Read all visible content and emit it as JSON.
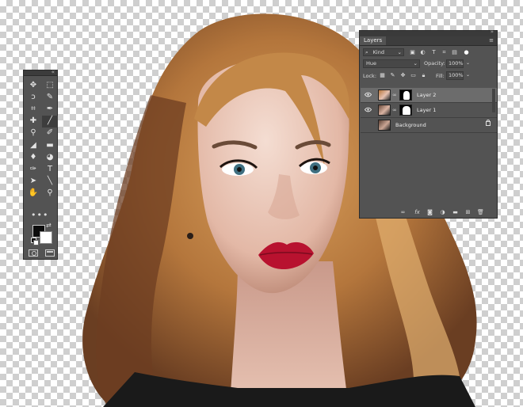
{
  "canvas": {
    "image": "portrait of woman with wavy hair and red lips on transparent background"
  },
  "tools_panel": {
    "more_glyph": "•••",
    "collapse_glyph": "«",
    "tools": [
      {
        "name": "move-tool",
        "glyph": "✥"
      },
      {
        "name": "marquee-tool",
        "glyph": "⬚"
      },
      {
        "name": "lasso-tool",
        "glyph": "ↄ"
      },
      {
        "name": "quick-select-tool",
        "glyph": "✎"
      },
      {
        "name": "crop-tool",
        "glyph": "⌗"
      },
      {
        "name": "eyedropper-tool",
        "glyph": "✒"
      },
      {
        "name": "healing-brush-tool",
        "glyph": "✚"
      },
      {
        "name": "brush-tool",
        "glyph": "╱"
      },
      {
        "name": "clone-stamp-tool",
        "glyph": "⚲"
      },
      {
        "name": "history-brush-tool",
        "glyph": "✐"
      },
      {
        "name": "eraser-tool",
        "glyph": "◢"
      },
      {
        "name": "gradient-tool",
        "glyph": "▬"
      },
      {
        "name": "blur-tool",
        "glyph": "♦"
      },
      {
        "name": "dodge-tool",
        "glyph": "◕"
      },
      {
        "name": "pen-tool",
        "glyph": "✑"
      },
      {
        "name": "type-tool",
        "glyph": "T"
      },
      {
        "name": "path-select-tool",
        "glyph": "➤"
      },
      {
        "name": "line-tool",
        "glyph": "╲"
      },
      {
        "name": "hand-tool",
        "glyph": "✋"
      },
      {
        "name": "zoom-tool",
        "glyph": "⚲"
      }
    ]
  },
  "layers_panel": {
    "tab_label": "Layers",
    "menu_glyph": "≡",
    "close_glyph": "»",
    "filter_kind": "Kind",
    "blend_mode": "Hue",
    "opacity_label": "Opacity:",
    "opacity_value": "100%",
    "lock_label": "Lock:",
    "fill_label": "Fill:",
    "fill_value": "100%",
    "layers": [
      {
        "name": "Layer 2",
        "selected": true,
        "visible": true,
        "has_mask": true
      },
      {
        "name": "Layer 1",
        "selected": false,
        "visible": true,
        "has_mask": true
      },
      {
        "name": "Background",
        "selected": false,
        "visible": false,
        "has_mask": false,
        "locked": true
      }
    ],
    "bottom_icons": [
      "link-icon",
      "fx-icon",
      "mask-icon",
      "adjustment-icon",
      "group-icon",
      "new-layer-icon",
      "trash-icon"
    ],
    "fx_label": "fx"
  },
  "colors": {
    "panel_bg": "#535353",
    "selected_row": "#6c6c6c",
    "foreground_color": "#0c0c0c",
    "background_color": "#ffffff",
    "lip_red": "#b8122f",
    "hair": "#b8763a"
  }
}
